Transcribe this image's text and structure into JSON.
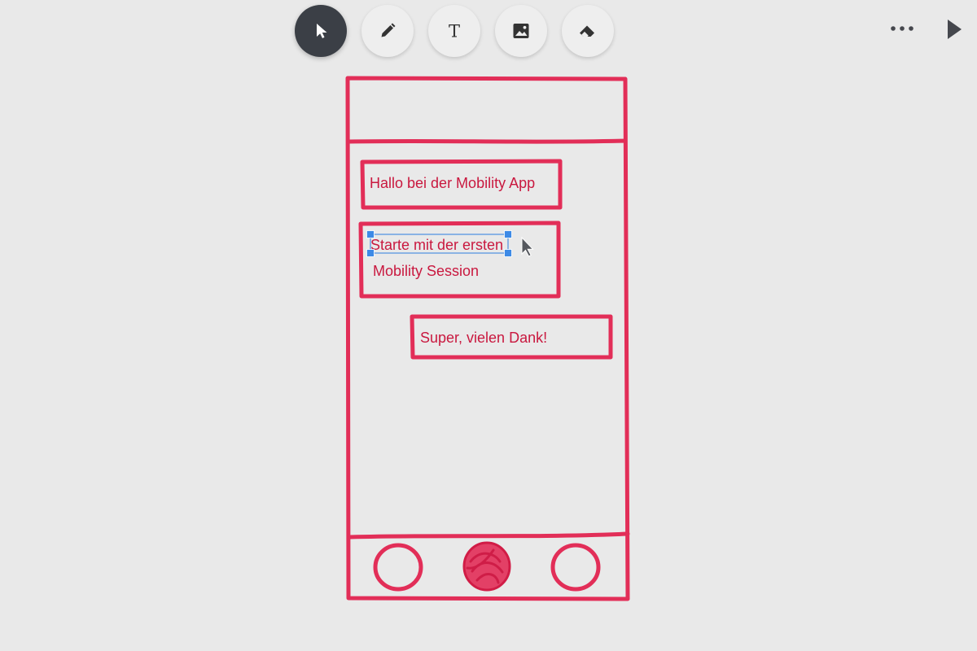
{
  "toolbar": {
    "tools": [
      {
        "id": "select",
        "icon": "cursor-arrow-icon",
        "active": true
      },
      {
        "id": "pen",
        "icon": "pencil-icon",
        "active": false
      },
      {
        "id": "text",
        "icon": "text-icon",
        "active": false
      },
      {
        "id": "image",
        "icon": "image-icon",
        "active": false
      },
      {
        "id": "eraser",
        "icon": "eraser-icon",
        "active": false
      }
    ],
    "text_tool_glyph": "T"
  },
  "controls": {
    "more_icon": "more-horizontal-icon",
    "play_icon": "play-icon"
  },
  "canvas": {
    "messages": [
      "Hallo bei der Mobility App",
      "Starte mit der ersten",
      "Mobility Session",
      "Super, vielen Dank!"
    ],
    "selected_message": 1
  },
  "colors": {
    "canvas_background": "#e9e9e9",
    "sketch_stroke": "#e22e58",
    "sketch_text": "#c9183f",
    "toolbar_active": "#3b3f46",
    "selection": "#3d8ae6"
  }
}
